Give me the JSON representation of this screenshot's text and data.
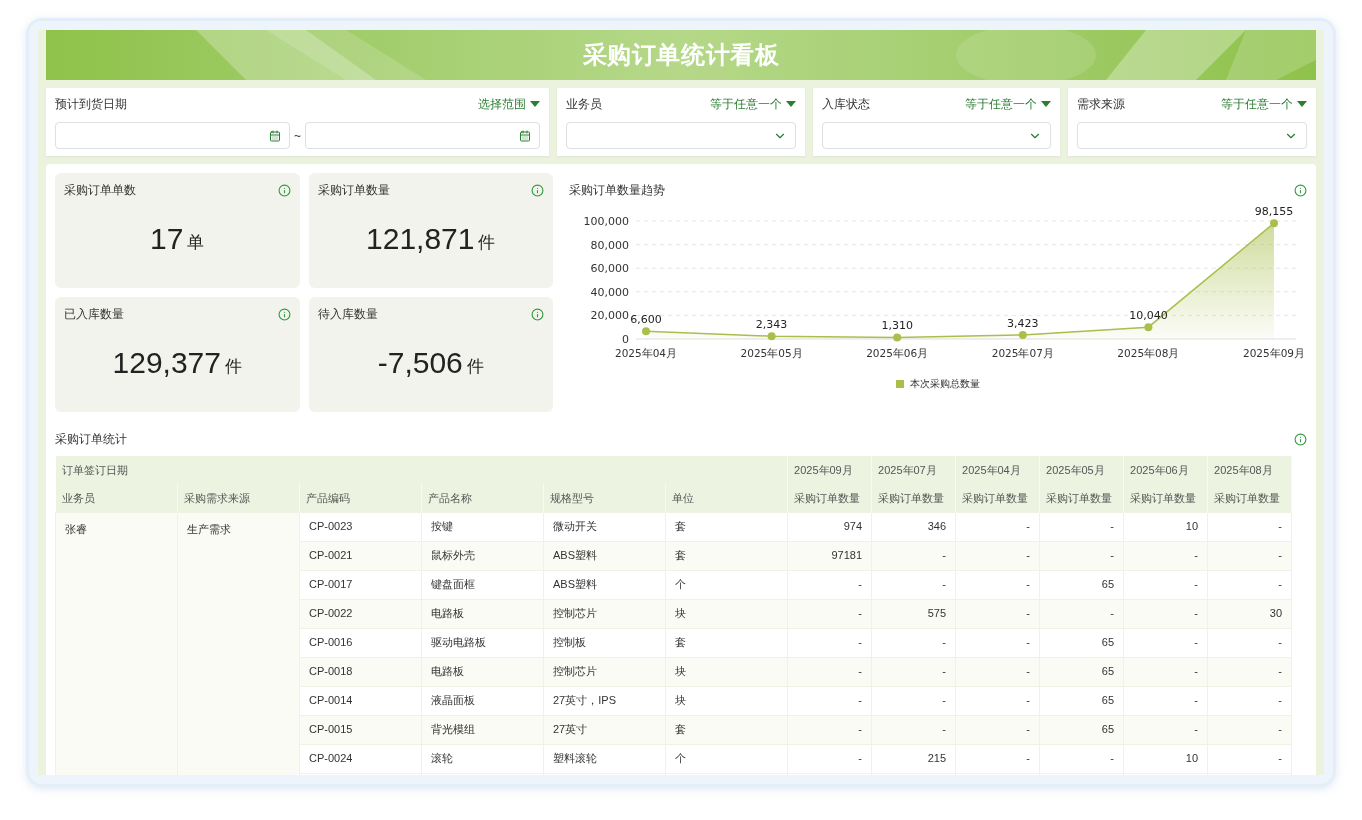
{
  "header": {
    "title": "采购订单统计看板"
  },
  "filters": [
    {
      "kind": "date_range",
      "label": "预计到货日期",
      "mode": "选择范围",
      "separator": "~"
    },
    {
      "kind": "select",
      "label": "业务员",
      "mode": "等于任意一个"
    },
    {
      "kind": "select",
      "label": "入库状态",
      "mode": "等于任意一个"
    },
    {
      "kind": "select",
      "label": "需求来源",
      "mode": "等于任意一个"
    }
  ],
  "kpis": [
    {
      "label": "采购订单单数",
      "value": "17",
      "unit": "单"
    },
    {
      "label": "采购订单数量",
      "value": "121,871",
      "unit": "件"
    },
    {
      "label": "已入库数量",
      "value": "129,377",
      "unit": "件"
    },
    {
      "label": "待入库数量",
      "value": "-7,506",
      "unit": "件"
    }
  ],
  "trend": {
    "title": "采购订单数量趋势",
    "chart_data": {
      "type": "area",
      "categories": [
        "2025年04月",
        "2025年05月",
        "2025年06月",
        "2025年07月",
        "2025年08月",
        "2025年09月"
      ],
      "series": [
        {
          "name": "本次采购总数量",
          "color": "#a8bf4c",
          "values": [
            6600,
            2343,
            1310,
            3423,
            10040,
            98155
          ]
        }
      ],
      "value_labels": [
        "6,600",
        "2,343",
        "1,310",
        "3,423",
        "10,040",
        "98,155"
      ],
      "ylim": [
        0,
        100000
      ],
      "grid": true,
      "yticks": [
        {
          "value": 0,
          "label": "0"
        },
        {
          "value": 20000,
          "label": "20,000"
        },
        {
          "value": 40000,
          "label": "40,000"
        },
        {
          "value": 60000,
          "label": "60,000"
        },
        {
          "value": 80000,
          "label": "80,000"
        },
        {
          "value": 100000,
          "label": "100,000"
        }
      ]
    }
  },
  "table": {
    "title": "采购订单统计",
    "group_header": "订单签订日期",
    "columns": [
      "业务员",
      "采购需求来源",
      "产品编码",
      "产品名称",
      "规格型号",
      "单位"
    ],
    "month_columns": [
      {
        "month": "2025年09月",
        "measure": "采购订单数量"
      },
      {
        "month": "2025年07月",
        "measure": "采购订单数量"
      },
      {
        "month": "2025年04月",
        "measure": "采购订单数量"
      },
      {
        "month": "2025年05月",
        "measure": "采购订单数量"
      },
      {
        "month": "2025年06月",
        "measure": "采购订单数量"
      },
      {
        "month": "2025年08月",
        "measure": "采购订单数量"
      }
    ],
    "salesperson": "张睿",
    "source": "生产需求",
    "rows": [
      {
        "code": "CP-0023",
        "name": "按键",
        "spec": "微动开关",
        "unit": "套",
        "values": [
          "974",
          "346",
          "-",
          "-",
          "10",
          "-"
        ]
      },
      {
        "code": "CP-0021",
        "name": "鼠标外壳",
        "spec": "ABS塑料",
        "unit": "套",
        "values": [
          "97181",
          "-",
          "-",
          "-",
          "-",
          "-"
        ]
      },
      {
        "code": "CP-0017",
        "name": "键盘面框",
        "spec": "ABS塑料",
        "unit": "个",
        "values": [
          "-",
          "-",
          "-",
          "65",
          "-",
          "-"
        ]
      },
      {
        "code": "CP-0022",
        "name": "电路板",
        "spec": "控制芯片",
        "unit": "块",
        "values": [
          "-",
          "575",
          "-",
          "-",
          "-",
          "30"
        ]
      },
      {
        "code": "CP-0016",
        "name": "驱动电路板",
        "spec": "控制板",
        "unit": "套",
        "values": [
          "-",
          "-",
          "-",
          "65",
          "-",
          "-"
        ]
      },
      {
        "code": "CP-0018",
        "name": "电路板",
        "spec": "控制芯片",
        "unit": "块",
        "values": [
          "-",
          "-",
          "-",
          "65",
          "-",
          "-"
        ]
      },
      {
        "code": "CP-0014",
        "name": "液晶面板",
        "spec": "27英寸，IPS",
        "unit": "块",
        "values": [
          "-",
          "-",
          "-",
          "65",
          "-",
          "-"
        ]
      },
      {
        "code": "CP-0015",
        "name": "背光模组",
        "spec": "27英寸",
        "unit": "套",
        "values": [
          "-",
          "-",
          "-",
          "65",
          "-",
          "-"
        ]
      },
      {
        "code": "CP-0024",
        "name": "滚轮",
        "spec": "塑料滚轮",
        "unit": "个",
        "values": [
          "-",
          "215",
          "-",
          "-",
          "10",
          "-"
        ]
      }
    ]
  }
}
